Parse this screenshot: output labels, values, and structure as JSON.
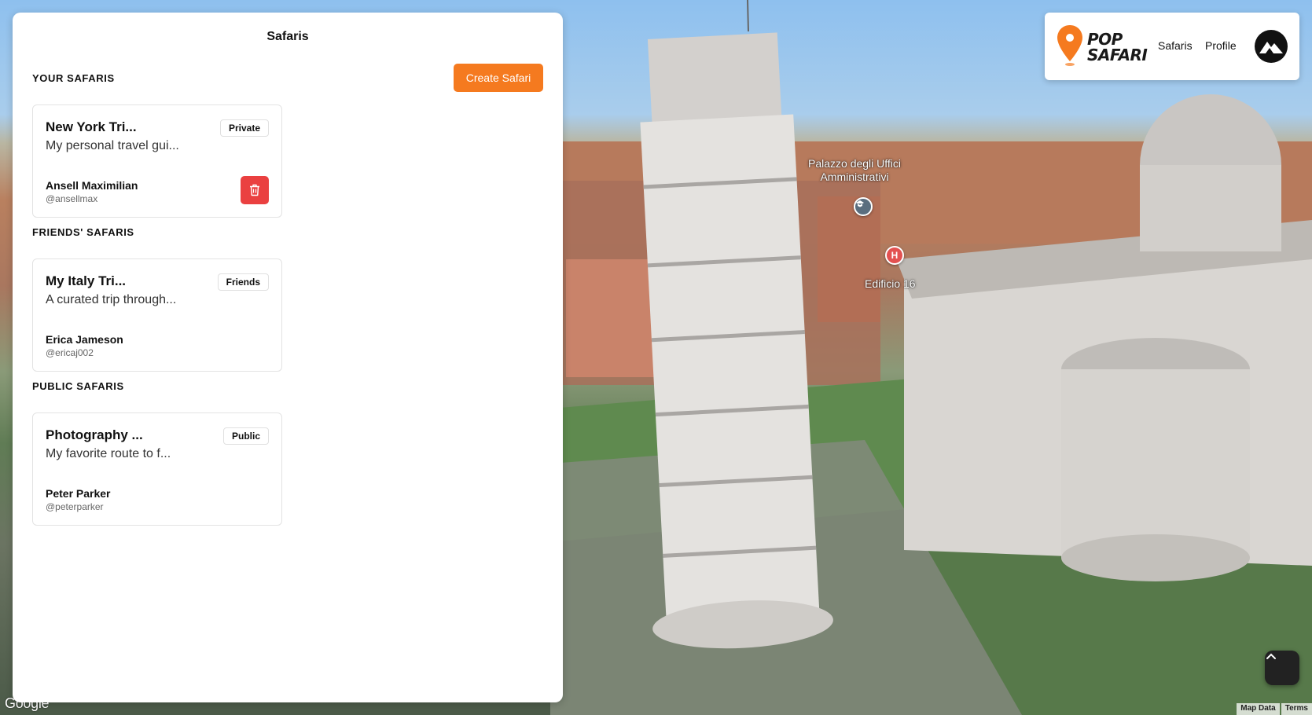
{
  "panel": {
    "title": "Safaris",
    "create_label": "Create Safari"
  },
  "sections": {
    "yours": {
      "heading": "YOUR SAFARIS",
      "card": {
        "title": "New York Tri...",
        "description": "My personal travel gui...",
        "badge": "Private",
        "owner_name": "Ansell Maximilian",
        "owner_handle": "@ansellmax"
      }
    },
    "friends": {
      "heading": "FRIENDS' SAFARIS",
      "card": {
        "title": "My Italy Tri...",
        "description": "A curated trip through...",
        "badge": "Friends",
        "owner_name": "Erica Jameson",
        "owner_handle": "@ericaj002"
      }
    },
    "public": {
      "heading": "PUBLIC SAFARIS",
      "card": {
        "title": "Photography ...",
        "description": "My favorite route to f...",
        "badge": "Public",
        "owner_name": "Peter Parker",
        "owner_handle": "@peterparker"
      }
    }
  },
  "nav": {
    "logo_line1": "POP",
    "logo_line2": "SAFARI",
    "links": [
      "Safaris",
      "Profile"
    ]
  },
  "map": {
    "labels": {
      "palazzo_line1": "Palazzo degli Uffici",
      "palazzo_line2": "Amministrativi",
      "edificio": "Edificio 16"
    },
    "hospital_pin": "H",
    "google": "Google",
    "attribution": [
      "Map Data",
      "Terms"
    ]
  },
  "colors": {
    "accent": "#f57a1f",
    "danger": "#ea4040"
  }
}
